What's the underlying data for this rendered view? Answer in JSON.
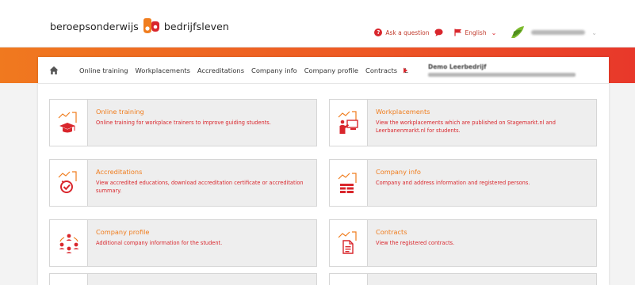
{
  "brand": {
    "part1": "beroepsonderwijs",
    "part2": "bedrijfsleven",
    "colors": {
      "orange": "#f07d1e",
      "red": "#d9262c"
    }
  },
  "header": {
    "ask_label": "Ask a question",
    "language_label": "English"
  },
  "nav": {
    "items": [
      "Online training",
      "Workplacements",
      "Accreditations",
      "Company info",
      "Company profile",
      "Contracts",
      "L"
    ],
    "company_name": "Demo Leerbedrijf"
  },
  "cards": [
    {
      "id": "online-training",
      "icon": "graduation-cap-icon",
      "title": "Online training",
      "description": "Online training for workplace trainers to improve guiding students."
    },
    {
      "id": "workplacements",
      "icon": "presentation-board-icon",
      "title": "Workplacements",
      "description": "View the workplacements which are published on Stagemarkt.nl and Leerbanenmarkt.nl for students."
    },
    {
      "id": "accreditations",
      "icon": "accreditation-check-icon",
      "title": "Accreditations",
      "description": "View accredited educations, download accreditation certificate or accreditation summary."
    },
    {
      "id": "company-info",
      "icon": "company-grid-icon",
      "title": "Company info",
      "description": "Company and address information and registered persons."
    },
    {
      "id": "company-profile",
      "icon": "people-network-icon",
      "title": "Company profile",
      "description": "Additional company information for the student."
    },
    {
      "id": "contracts",
      "icon": "document-icon",
      "title": "Contracts",
      "description": "View the registered contracts."
    }
  ]
}
